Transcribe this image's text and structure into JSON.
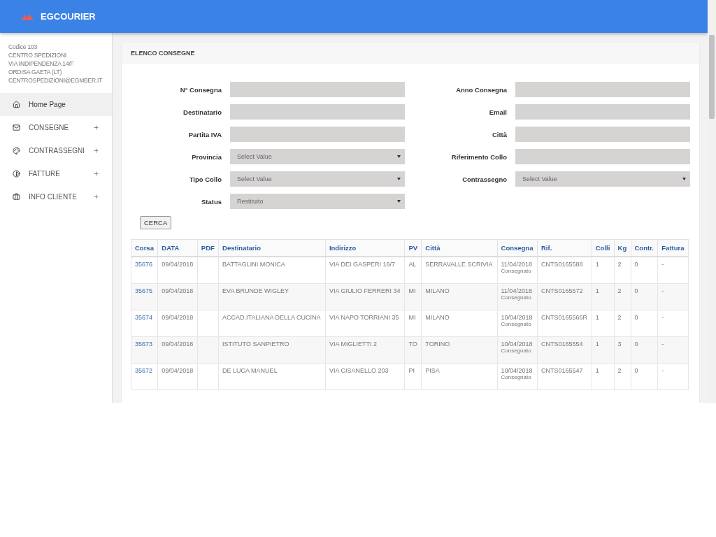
{
  "header": {
    "brand": "EGCOURIER"
  },
  "sidebar": {
    "info": [
      "Codice 103",
      "CENTRO SPEDIZIONI",
      "VIA INDIPENDENZA 14/F",
      "ORDISA GAETA (LT)",
      "CENTROSPEDIZIONI@EGMBER.IT"
    ],
    "items": [
      {
        "kind": "home",
        "label": "Home Page",
        "selected": true,
        "expandable": false
      },
      {
        "kind": "mail",
        "label": "CONSEGNE",
        "selected": false,
        "expandable": true
      },
      {
        "kind": "palette",
        "label": "CONTRASSEGNI",
        "selected": false,
        "expandable": true
      },
      {
        "kind": "contrast",
        "label": "FATTURE",
        "selected": false,
        "expandable": true
      },
      {
        "kind": "briefcase",
        "label": "INFO CLIENTE",
        "selected": false,
        "expandable": true
      }
    ]
  },
  "panel": {
    "title": "ELENCO CONSEGNE",
    "fields": [
      {
        "label": "N° Consegna",
        "kind": "text"
      },
      {
        "label": "Anno Consegna",
        "kind": "text"
      },
      {
        "label": "Destinatario",
        "kind": "text"
      },
      {
        "label": "Email",
        "kind": "text"
      },
      {
        "label": "Partita IVA",
        "kind": "text"
      },
      {
        "label": "Città",
        "kind": "text"
      },
      {
        "label": "Provincia",
        "kind": "select",
        "value": "Select Value"
      },
      {
        "label": "Riferimento Collo",
        "kind": "text"
      },
      {
        "label": "Tipo Collo",
        "kind": "select",
        "value": "Select Value"
      },
      {
        "label": "Contrassegno",
        "kind": "select",
        "value": "Select Value"
      },
      {
        "label": "Status",
        "kind": "select",
        "value": "Restituito"
      }
    ],
    "search_button": "CERCA",
    "table": {
      "columns": [
        "Corsa",
        "DATA",
        "PDF",
        "Destinatario",
        "Indirizzo",
        "PV",
        "Città",
        "Consegna",
        "Rif.",
        "Colli",
        "Kg",
        "Contr.",
        "Fattura"
      ],
      "rows": [
        {
          "corsa": "35676",
          "data": "09/04/2018",
          "destinatario": "BATTAGLINI MONICA",
          "indirizzo": "VIA DEI GASPERI 16/7",
          "pv": "AL",
          "citta": "SERRAVALLE SCRIVIA",
          "consegna": "11/04/2018",
          "stato": "Consegnato",
          "rif": "CNTS0165588",
          "colli": "1",
          "kg": "2",
          "contr": "0",
          "fattura": "-"
        },
        {
          "corsa": "35675",
          "data": "09/04/2018",
          "destinatario": "EVA BRUNDE WIGLEY",
          "indirizzo": "VIA GIULIO FERRERI 34",
          "pv": "MI",
          "citta": "MILANO",
          "consegna": "11/04/2018",
          "stato": "Consegnato",
          "rif": "CNTS0165572",
          "colli": "1",
          "kg": "2",
          "contr": "0",
          "fattura": "-"
        },
        {
          "corsa": "35674",
          "data": "09/04/2018",
          "destinatario": "ACCAD.ITALIANA DELLA CUCINA",
          "indirizzo": "VIA NAPO TORRIANI 35",
          "pv": "MI",
          "citta": "MILANO",
          "consegna": "10/04/2018",
          "stato": "Consegnato",
          "rif": "CNTS0165566R",
          "colli": "1",
          "kg": "2",
          "contr": "0",
          "fattura": "-"
        },
        {
          "corsa": "35673",
          "data": "09/04/2018",
          "destinatario": "ISTITUTO SANPIETRO",
          "indirizzo": "VIA MIGLIETTI 2",
          "pv": "TO",
          "citta": "TORINO",
          "consegna": "10/04/2018",
          "stato": "Consegnato",
          "rif": "CNTS0165554",
          "colli": "1",
          "kg": "3",
          "contr": "0",
          "fattura": "-"
        },
        {
          "corsa": "35672",
          "data": "09/04/2018",
          "destinatario": "DE LUCA MANUEL",
          "indirizzo": "VIA CISANELLO 203",
          "pv": "PI",
          "citta": "PISA",
          "consegna": "10/04/2018",
          "stato": "Consegnato",
          "rif": "CNTS0165547",
          "colli": "1",
          "kg": "2",
          "contr": "0",
          "fattura": "-"
        }
      ]
    }
  }
}
